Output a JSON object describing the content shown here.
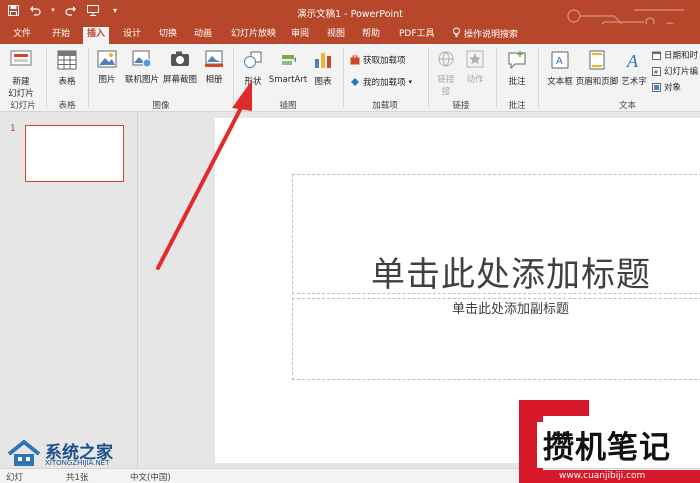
{
  "window": {
    "title": "演示文稿1 - PowerPoint"
  },
  "qat": {
    "save": "save-icon",
    "undo": "undo-icon",
    "redo": "redo-icon",
    "start": "slideshow-icon",
    "more": "customize-icon"
  },
  "tabs": [
    {
      "label": "文件"
    },
    {
      "label": "开始"
    },
    {
      "label": "插入"
    },
    {
      "label": "设计"
    },
    {
      "label": "切换"
    },
    {
      "label": "动画"
    },
    {
      "label": "幻灯片放映"
    },
    {
      "label": "审阅"
    },
    {
      "label": "视图"
    },
    {
      "label": "帮助"
    },
    {
      "label": "PDF工具"
    }
  ],
  "tell_me": "操作说明搜索",
  "ribbon": {
    "slides": {
      "new_slide": "新建",
      "new_slide2": "幻灯片",
      "group": "幻灯片"
    },
    "tables": {
      "table": "表格",
      "group": "表格"
    },
    "images": {
      "picture": "图片",
      "online": "联机图片",
      "screenshot": "屏幕截图",
      "album": "相册",
      "group": "图像"
    },
    "illustrations": {
      "shapes": "形状",
      "smartart": "SmartArt",
      "chart": "图表",
      "group": "插图"
    },
    "addins": {
      "get": "获取加载项",
      "mine": "我的加载项",
      "group": "加载项"
    },
    "links": {
      "link": "链接",
      "link2": "接",
      "action": "动作",
      "group": "链接"
    },
    "comments": {
      "comment": "批注",
      "group": "批注"
    },
    "text": {
      "textbox": "文本框",
      "header_footer": "页眉和页脚",
      "wordart": "艺术字",
      "datetime": "日期和时",
      "slidenum": "幻灯片编",
      "object": "对象",
      "group": "文本"
    }
  },
  "thumbs": {
    "number": "1"
  },
  "slide": {
    "title_placeholder": "单击此处添加标题",
    "subtitle_placeholder": "单击此处添加副标题"
  },
  "status": {
    "slide_info": "幻灯",
    "count": "共1张",
    "lang": "中文(中国)"
  },
  "watermarks": {
    "left_cn": "系统之家",
    "left_en": "XITONGZHIJIA.NET",
    "right_cn": "攒机笔记",
    "right_en": "www.cuanjibiji.com"
  },
  "colors": {
    "accent": "#b7472a",
    "arrow": "#e02b2b"
  }
}
